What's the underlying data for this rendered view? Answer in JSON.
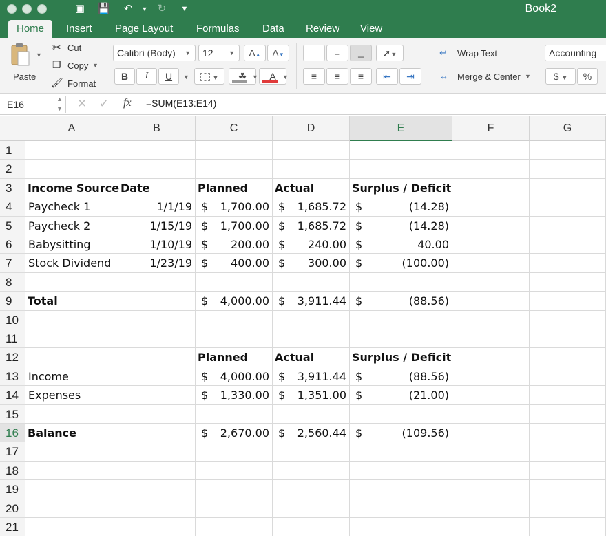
{
  "window": {
    "title": "Book2"
  },
  "tabs": [
    "Home",
    "Insert",
    "Page Layout",
    "Formulas",
    "Data",
    "Review",
    "View"
  ],
  "active_tab": "Home",
  "ribbon": {
    "paste": "Paste",
    "cut": "Cut",
    "copy": "Copy",
    "format": "Format",
    "font_name": "Calibri (Body)",
    "font_size": "12",
    "bold": "B",
    "italic": "I",
    "underline": "U",
    "wrap_text": "Wrap Text",
    "merge_center": "Merge & Center",
    "number_format": "Accounting",
    "currency": "$",
    "percent": "%",
    "grow_font": "A",
    "shrink_font": "A",
    "font_color": "A"
  },
  "formula_bar": {
    "name_box": "E16",
    "fx": "fx",
    "formula": "=SUM(E13:E14)"
  },
  "columns": [
    "A",
    "B",
    "C",
    "D",
    "E",
    "F",
    "G"
  ],
  "selected_column": "E",
  "selected_row": "16",
  "rows": [
    "1",
    "2",
    "3",
    "4",
    "5",
    "6",
    "7",
    "8",
    "9",
    "10",
    "11",
    "12",
    "13",
    "14",
    "15",
    "16",
    "17",
    "18",
    "19",
    "20",
    "21"
  ],
  "table1": {
    "headers": [
      "Income Source",
      "Date",
      "Planned",
      "Actual",
      "Surplus / Deficit"
    ],
    "rows": [
      [
        "Paycheck 1",
        "1/1/19",
        "1,700.00",
        "1,685.72",
        "(14.28)"
      ],
      [
        "Paycheck 2",
        "1/15/19",
        "1,700.00",
        "1,685.72",
        "(14.28)"
      ],
      [
        "Babysitting",
        "1/10/19",
        "200.00",
        "240.00",
        "40.00"
      ],
      [
        "Stock Dividend",
        "1/23/19",
        "400.00",
        "300.00",
        "(100.00)"
      ]
    ],
    "total": [
      "Total",
      "",
      "4,000.00",
      "3,911.44",
      "(88.56)"
    ]
  },
  "table2": {
    "headers": [
      "Planned",
      "Actual",
      "Surplus / Deficit"
    ],
    "rows": [
      [
        "Income",
        "4,000.00",
        "3,911.44",
        "(88.56)"
      ],
      [
        "Expenses",
        "1,330.00",
        "1,351.00",
        "(21.00)"
      ]
    ],
    "balance": [
      "Balance",
      "2,670.00",
      "2,560.44",
      "(109.56)"
    ]
  },
  "currency_symbol": "$",
  "colors": {
    "accent": "#2f7d4e",
    "ribbon_bg": "#f3f3f3",
    "font_color_bar": "#e03a3a"
  }
}
